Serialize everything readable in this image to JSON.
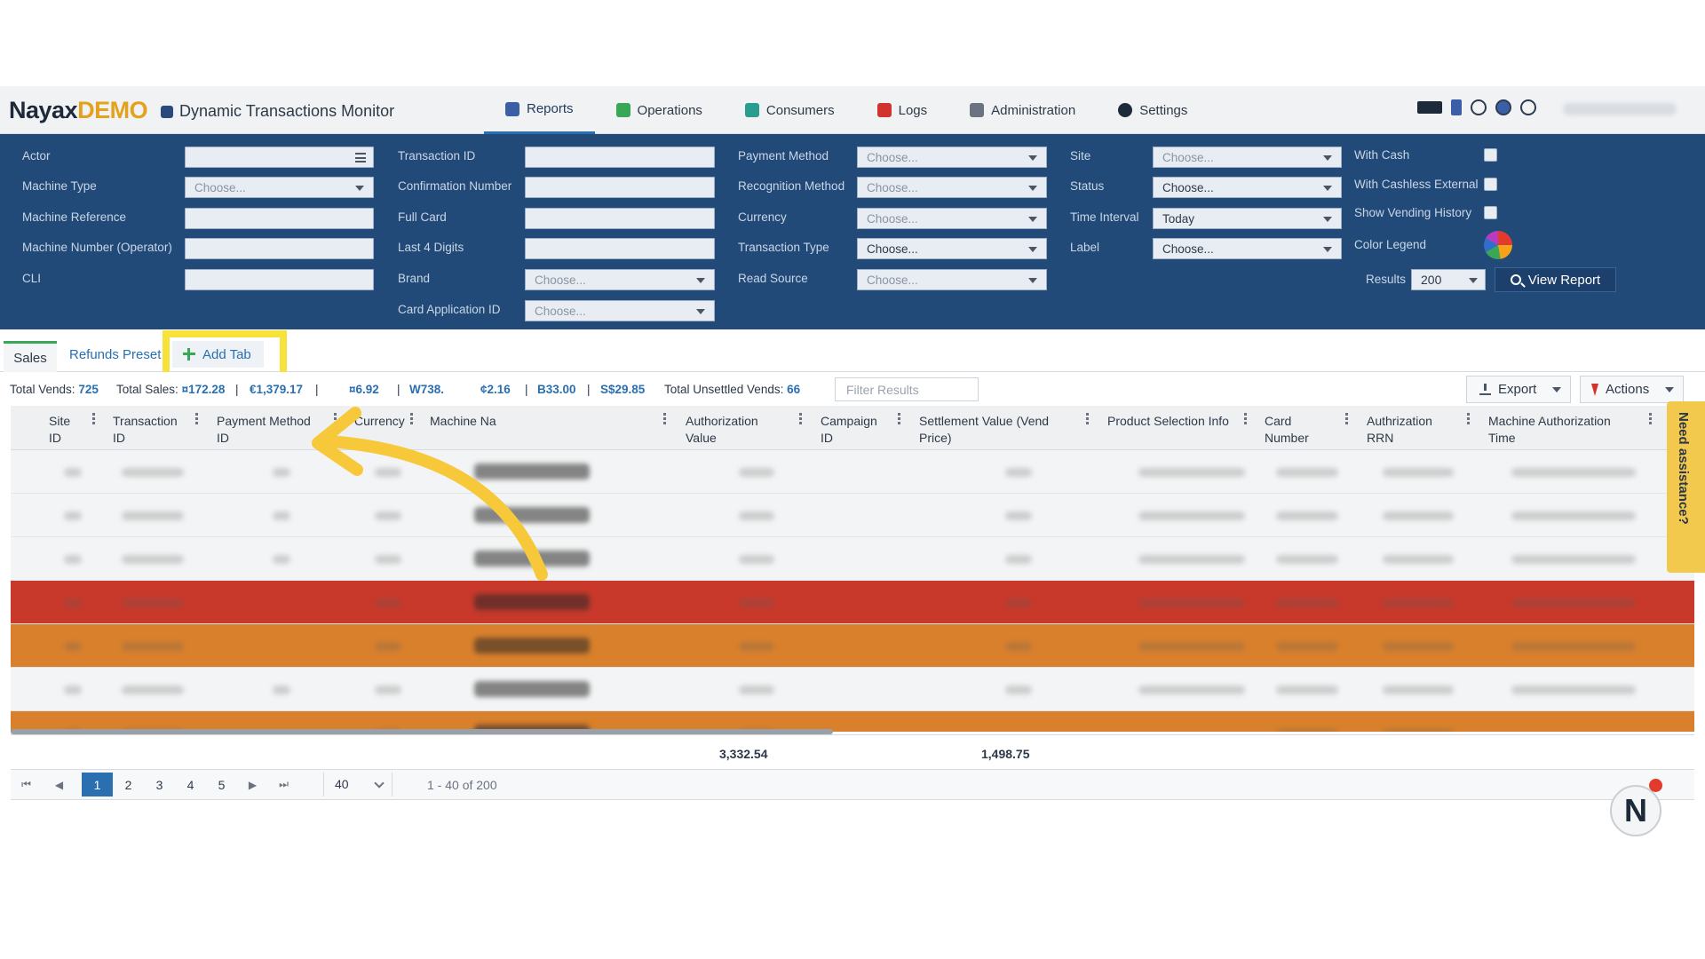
{
  "brand": {
    "name": "Nayax",
    "suffix": "DEMO",
    "app_title": "Dynamic Transactions Monitor"
  },
  "nav": [
    {
      "label": "Reports",
      "icon": "reports-icon",
      "active": true
    },
    {
      "label": "Operations",
      "icon": "operations-icon"
    },
    {
      "label": "Consumers",
      "icon": "consumers-icon"
    },
    {
      "label": "Logs",
      "icon": "logs-icon"
    },
    {
      "label": "Administration",
      "icon": "administration-icon"
    },
    {
      "label": "Settings",
      "icon": "settings-icon"
    }
  ],
  "filters": {
    "actor": "Actor",
    "machine_type": "Machine Type",
    "machine_reference": "Machine Reference",
    "machine_number": "Machine Number (Operator)",
    "cli": "CLI",
    "transaction_id": "Transaction ID",
    "confirmation_number": "Confirmation Number",
    "full_card": "Full Card",
    "last4": "Last 4 Digits",
    "brand": "Brand",
    "card_app_id": "Card Application ID",
    "payment_method": "Payment Method",
    "recognition_method": "Recognition Method",
    "currency": "Currency",
    "transaction_type": "Transaction Type",
    "read_source": "Read Source",
    "site": "Site",
    "status": "Status",
    "time_interval": "Time Interval",
    "label": "Label",
    "with_cash": "With Cash",
    "with_cashless_external": "With Cashless External",
    "show_vending_history": "Show Vending History",
    "color_legend": "Color Legend",
    "results": "Results",
    "choose": "Choose...",
    "status_value": "Choose...",
    "transaction_type_value": "Choose...",
    "time_interval_value": "Today",
    "label_value": "Choose...",
    "results_value": "200",
    "view_report": "View Report"
  },
  "tabs": {
    "sales": "Sales",
    "refunds": "Refunds Preset",
    "add": "Add Tab"
  },
  "summary": {
    "total_vends_label": "Total Vends:",
    "total_vends": "725",
    "total_sales_label": "Total Sales:",
    "s1": "¤172.28",
    "s2": "€1,379.17",
    "s3": "¤6.92",
    "s4": "W738.",
    "s5": "¢2.16",
    "s6": "B33.00",
    "s7": "S$29.85",
    "unsettled_label": "Total Unsettled Vends:",
    "unsettled": "66",
    "filter_placeholder": "Filter Results",
    "export": "Export",
    "actions": "Actions"
  },
  "columns": [
    "Site ID",
    "Transaction ID",
    "Payment Method ID",
    "Currency",
    "Machine Na",
    "Authorization Value",
    "Campaign ID",
    "Settlement Value (Vend Price)",
    "Product Selection Info",
    "Card Number",
    "Authrization RRN",
    "Machine Authorization Time"
  ],
  "totals": {
    "auth_value": "3,332.54",
    "settlement_value": "1,498.75"
  },
  "pager": {
    "pages": [
      "1",
      "2",
      "3",
      "4",
      "5"
    ],
    "page_size": "40",
    "info": "1 - 40 of 200"
  },
  "help": {
    "label": "Need assistance?"
  },
  "colors": {
    "header_bg": "#224a78",
    "accent": "#2a6fb0",
    "highlight": "#f6e23a",
    "row_red": "#c8392b",
    "row_orange": "#d9802c"
  }
}
